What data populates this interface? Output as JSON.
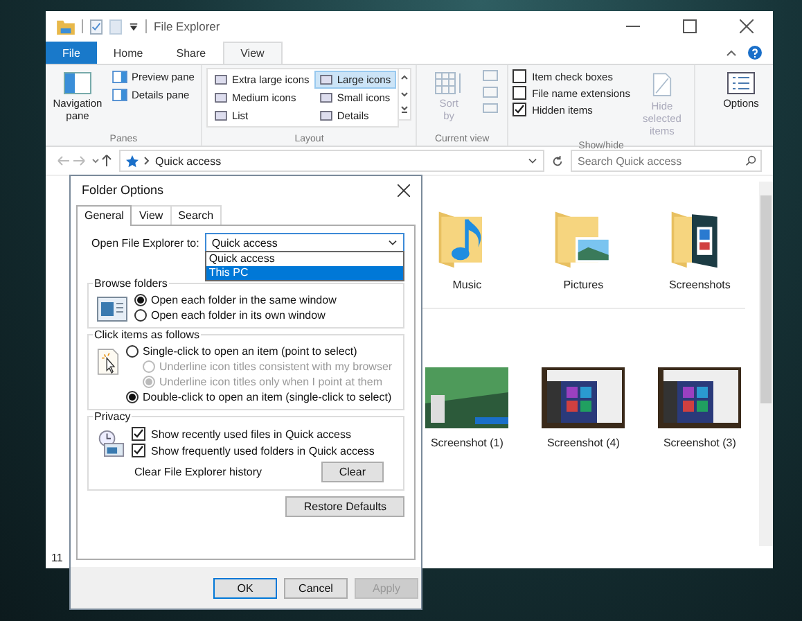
{
  "explorer": {
    "title": "File Explorer",
    "tabs": [
      {
        "label": "File",
        "kind": "file",
        "selected": false
      },
      {
        "label": "Home",
        "kind": "tab",
        "selected": false
      },
      {
        "label": "Share",
        "kind": "tab",
        "selected": false
      },
      {
        "label": "View",
        "kind": "tab",
        "selected": true
      }
    ],
    "panes": {
      "nav_button": "Navigation pane",
      "items": [
        "Preview pane",
        "Details pane"
      ],
      "label": "Panes"
    },
    "layout": {
      "items": [
        {
          "label": "Extra large icons",
          "selected": false
        },
        {
          "label": "Large icons",
          "selected": true
        },
        {
          "label": "Medium icons",
          "selected": false
        },
        {
          "label": "Small icons",
          "selected": false
        },
        {
          "label": "List",
          "selected": false
        },
        {
          "label": "Details",
          "selected": false
        }
      ],
      "label": "Layout"
    },
    "current_view": {
      "sort_button": "Sort by",
      "label": "Current view"
    },
    "show_hide": {
      "checkboxes": [
        {
          "label": "Item check boxes",
          "checked": false
        },
        {
          "label": "File name extensions",
          "checked": false
        },
        {
          "label": "Hidden items",
          "checked": true
        }
      ],
      "hide_selected": "Hide selected items",
      "label": "Show/hide"
    },
    "options_button": "Options",
    "address": "Quick access",
    "search_placeholder": "Search Quick access",
    "folders": [
      {
        "name": "Music",
        "kind": "music"
      },
      {
        "name": "Pictures",
        "kind": "pictures"
      },
      {
        "name": "Screenshots",
        "kind": "screenshots"
      }
    ],
    "recent_files": [
      {
        "name": "Screenshot (1)",
        "kind": "landscape"
      },
      {
        "name": "Screenshot (4)",
        "kind": "start-menu"
      },
      {
        "name": "Screenshot (3)",
        "kind": "start-menu"
      }
    ],
    "status_bar": "11"
  },
  "dialog": {
    "title": "Folder Options",
    "tabs": [
      {
        "label": "General",
        "selected": true
      },
      {
        "label": "View",
        "selected": false
      },
      {
        "label": "Search",
        "selected": false
      }
    ],
    "open_to_label": "Open File Explorer to:",
    "open_to_value": "Quick access",
    "dropdown_options": [
      {
        "label": "Quick access",
        "selected": false
      },
      {
        "label": "This PC",
        "selected": true
      }
    ],
    "browse": {
      "label": "Browse folders",
      "options": [
        {
          "label": "Open each folder in the same window",
          "selected": true
        },
        {
          "label": "Open each folder in its own window",
          "selected": false
        }
      ]
    },
    "click": {
      "label": "Click items as follows",
      "options": [
        {
          "label": "Single-click to open an item (point to select)",
          "selected": false,
          "disabled": false,
          "children": [
            {
              "label": "Underline icon titles consistent with my browser",
              "selected": false,
              "disabled": true
            },
            {
              "label": "Underline icon titles only when I point at them",
              "selected": true,
              "disabled": true
            }
          ]
        },
        {
          "label": "Double-click to open an item (single-click to select)",
          "selected": true,
          "disabled": false
        }
      ]
    },
    "privacy": {
      "label": "Privacy",
      "checkboxes": [
        {
          "label": "Show recently used files in Quick access",
          "checked": true
        },
        {
          "label": "Show frequently used folders in Quick access",
          "checked": true
        }
      ],
      "clear_label": "Clear File Explorer history",
      "clear_button": "Clear"
    },
    "restore_button": "Restore Defaults",
    "buttons": [
      {
        "label": "OK",
        "kind": "default",
        "disabled": false
      },
      {
        "label": "Cancel",
        "kind": "normal",
        "disabled": false
      },
      {
        "label": "Apply",
        "kind": "normal",
        "disabled": true
      }
    ]
  }
}
